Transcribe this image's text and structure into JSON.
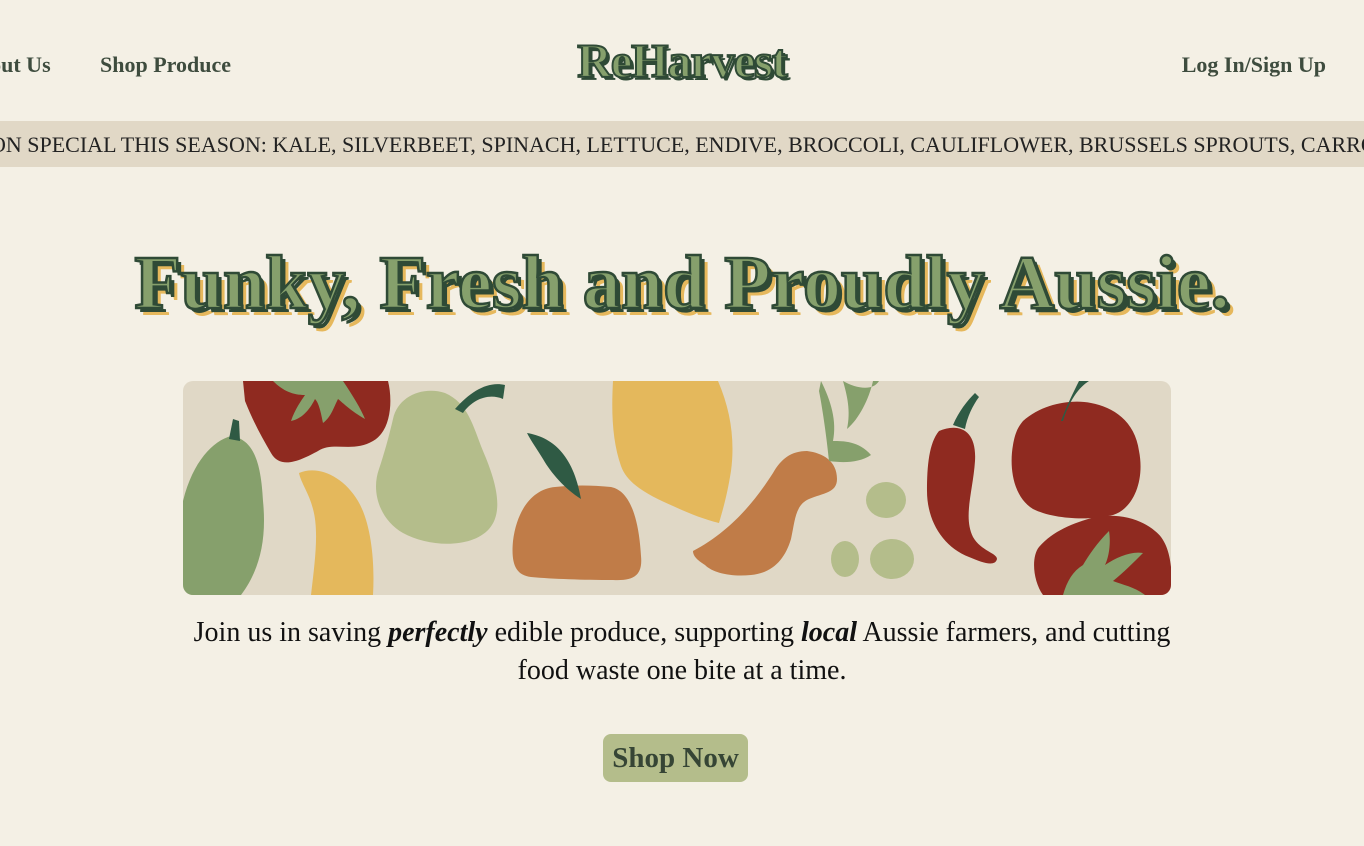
{
  "header": {
    "nav_about": "About Us",
    "nav_shop": "Shop Produce",
    "logo": "ReHarvest",
    "nav_login": "Log In/Sign Up"
  },
  "marquee": {
    "text": "ON SPECIAL THIS SEASON: KALE, SILVERBEET, SPINACH, LETTUCE, ENDIVE, BROCCOLI, CAULIFLOWER, BRUSSELS SPROUTS, CARROTS, BEETROOT"
  },
  "hero": {
    "title": "Funky, Fresh and Proudly Aussie.",
    "tagline_part1": "Join us in saving ",
    "tagline_em1": "perfectly",
    "tagline_part2": " edible produce, supporting ",
    "tagline_em2": "local",
    "tagline_part3": " Aussie farmers, and cutting food waste one bite at a time.",
    "cta_label": "Shop Now"
  },
  "banner": {
    "illustration": "produce-illustration",
    "colors": {
      "background": "#e0d8c6",
      "sage": "#86a06c",
      "pale_green": "#b4bd8b",
      "mustard": "#e4b85c",
      "orange": "#c07c48",
      "red": "#8f2a20",
      "dark_green": "#2f5a44"
    }
  },
  "colors": {
    "page_background": "#f4f0e5",
    "marquee_background": "#e1d8c6",
    "heading_fill": "#86a06c",
    "heading_outline": "#2f4a36",
    "heading_shadow": "#e6b85c",
    "button_background": "#b4bd8b"
  }
}
